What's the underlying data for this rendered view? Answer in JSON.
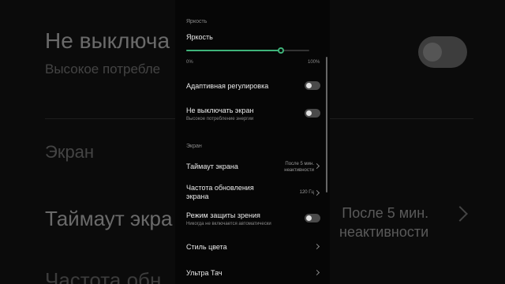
{
  "background": {
    "line1": "Не выключа",
    "line2": "Высокое потребле",
    "line3": "Экран",
    "line4": "Таймаут экра",
    "line5a": "После 5 мин.",
    "line5b": "неактивности",
    "line6": "Частота обн"
  },
  "panel": {
    "section_brightness": "Яркость",
    "brightness": {
      "title": "Яркость",
      "min_label": "0%",
      "max_label": "100%",
      "level": 0.77,
      "accent": "#3fb37a"
    },
    "adaptive": {
      "title": "Адаптивная регулировка",
      "enabled": false
    },
    "screen_on": {
      "title": "Не выключать экран",
      "subtitle": "Высокое потребление энергии",
      "enabled": false
    },
    "section_screen": "Экран",
    "timeout": {
      "title": "Таймаут экрана",
      "value_line1": "После 5 мин.",
      "value_line2": "неактивности"
    },
    "refresh": {
      "title_line1": "Частота обновления",
      "title_line2": "экрана",
      "value": "120 Гц"
    },
    "eye_care": {
      "title": "Режим защиты зрения",
      "subtitle": "Никогда не включается автоматически",
      "enabled": false
    },
    "color_style": {
      "title": "Стиль цвета"
    },
    "ultra_touch": {
      "title": "Ультра Тач"
    }
  }
}
